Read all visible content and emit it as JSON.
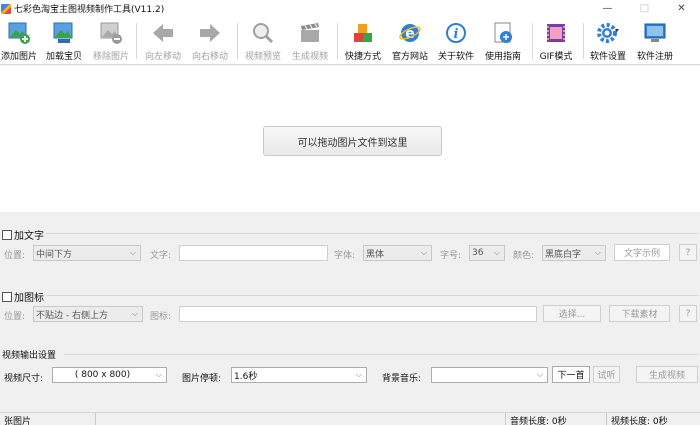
{
  "window": {
    "title": "七彩色淘宝主图视频制作工具(V11.2)",
    "controls": [
      "—",
      "□",
      "✕"
    ]
  },
  "toolbar": {
    "items": [
      {
        "label": "添加图片",
        "icon": "add-image-icon",
        "enabled": true
      },
      {
        "label": "加载宝贝",
        "icon": "load-product-icon",
        "enabled": true
      },
      {
        "label": "移除图片",
        "icon": "remove-image-icon",
        "enabled": false
      },
      {
        "label": "向左移动",
        "icon": "arrow-left-icon",
        "enabled": false
      },
      {
        "label": "向右移动",
        "icon": "arrow-right-icon",
        "enabled": false
      },
      {
        "label": "视频预览",
        "icon": "magnifier-icon",
        "enabled": false
      },
      {
        "label": "生成视频",
        "icon": "clapperboard-icon",
        "enabled": false
      },
      {
        "label": "快捷方式",
        "icon": "cubes-icon",
        "enabled": true
      },
      {
        "label": "官方网站",
        "icon": "ie-globe-icon",
        "enabled": true
      },
      {
        "label": "关于软件",
        "icon": "info-icon",
        "enabled": true
      },
      {
        "label": "使用指南",
        "icon": "guide-icon",
        "enabled": true
      },
      {
        "label": "GIF模式",
        "icon": "gif-film-icon",
        "enabled": true
      },
      {
        "label": "软件设置",
        "icon": "gear-icon",
        "enabled": true
      },
      {
        "label": "软件注册",
        "icon": "monitor-icon",
        "enabled": true
      }
    ]
  },
  "dropzone": {
    "button_label": "可以拖动图片文件到这里"
  },
  "text_section": {
    "checkbox_label": "加文字",
    "position_label": "位置:",
    "position_value": "中间下方",
    "text_label": "文字:",
    "font_label": "字体:",
    "font_value": "黑体",
    "size_label": "字号:",
    "size_value": "36",
    "color_label": "颜色:",
    "color_value": "黑底白字",
    "sample_button": "文字示例",
    "help_button": "?"
  },
  "logo_section": {
    "checkbox_label": "加图标",
    "position_label": "位置:",
    "position_value": "不贴边 - 右侧上方",
    "icon_label": "图标:",
    "select_button": "选择...",
    "download_button": "下载素材",
    "help_button": "?"
  },
  "video_section": {
    "title": "视频输出设置",
    "size_label": "视频尺寸:",
    "size_value": "( 800 x  800)",
    "pause_label": "图片停顿:",
    "pause_value": "1.6秒",
    "music_label": "背景音乐:",
    "music_value": "",
    "next_button": "下一首",
    "listen_button": "试听",
    "generate_button": "生成视频"
  },
  "status": {
    "images": "张图片",
    "audio": "音频长度: 0秒",
    "video": "视频长度: 0秒"
  },
  "colors": {
    "accent_blue": "#2f7fd6",
    "green": "#3aa34a",
    "disabled_text": "#9a9a9a"
  }
}
